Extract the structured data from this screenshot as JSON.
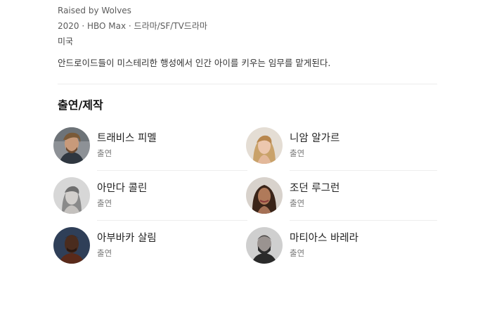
{
  "info": {
    "original_title": "Raised by Wolves",
    "year_line": "2020 · HBO Max · 드라마/SF/TV드라마",
    "country": "미국",
    "synopsis": "안드로이드들이 미스테리한 행성에서 인간 아이를 키우는 임무를 맡게된다."
  },
  "cast_section": {
    "title": "출연/제작",
    "members": [
      {
        "name": "트래비스 피멜",
        "role": "출연",
        "icon": "portrait-travis-fimmel"
      },
      {
        "name": "니암 알가르",
        "role": "출연",
        "icon": "portrait-niamh-algar"
      },
      {
        "name": "아만다 콜린",
        "role": "출연",
        "icon": "portrait-amanda-collin"
      },
      {
        "name": "조던 루그런",
        "role": "출연",
        "icon": "portrait-jordan-loughran"
      },
      {
        "name": "아부바카 살림",
        "role": "출연",
        "icon": "portrait-abubakar-salim"
      },
      {
        "name": "마티아스 바레라",
        "role": "출연",
        "icon": "portrait-matias-varela"
      }
    ]
  }
}
